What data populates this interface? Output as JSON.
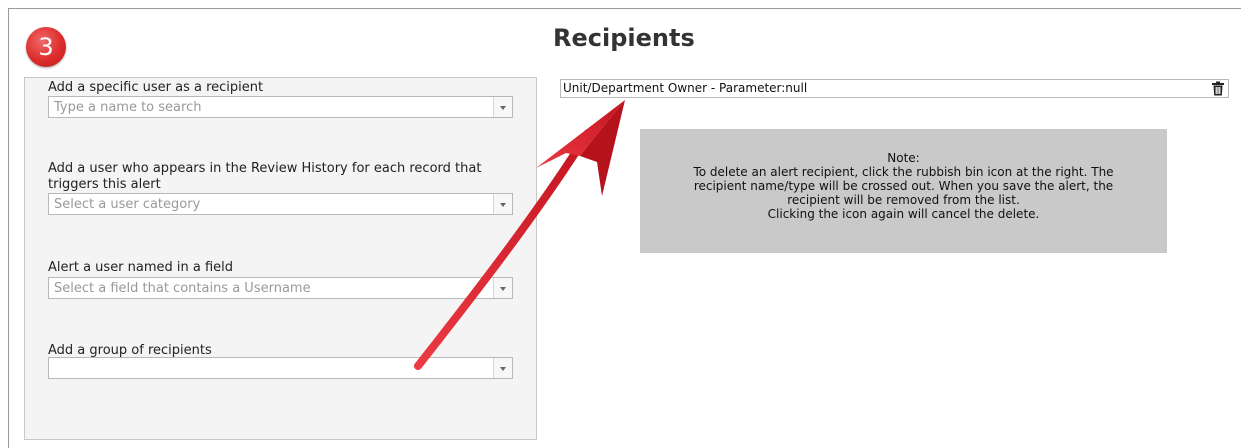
{
  "step_badge": "3",
  "page_title": "Recipients",
  "specific_user": {
    "label": "Add a specific user as a recipient",
    "placeholder": "Type a name to search"
  },
  "review_history_user": {
    "label": "Add a user who appears in the Review History for each record that triggers this alert",
    "placeholder": "Select a user category"
  },
  "field_user": {
    "label": "Alert a user named in a field",
    "placeholder": "Select a field that contains a Username"
  },
  "group_recipients": {
    "label": "Add a group of recipients",
    "value": ""
  },
  "recipient_list": {
    "items": [
      "Unit/Department Owner - Parameter:null"
    ],
    "delete_icon": "trash-icon"
  },
  "note": {
    "text": "Note:\nTo delete an alert recipient, click the rubbish bin icon at the right. The\nrecipient name/type will be crossed out. When you save the alert, the\nrecipient will be removed from the list.\nClicking the icon again will cancel the delete."
  },
  "colors": {
    "badge": "#dd2c2c",
    "arrow": "#d81f2a",
    "note_bg": "#c9c9c9",
    "panel_bg": "#f4f4f4"
  }
}
